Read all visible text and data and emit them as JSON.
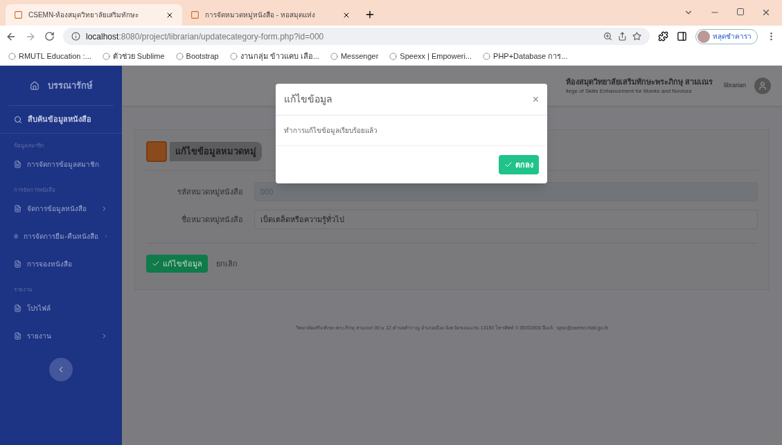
{
  "browser": {
    "tabs": [
      {
        "title": "CSEMN-ห้องสมุดวิทยาลัยเสริมทักษะ",
        "selected": true
      },
      {
        "title": "การจัดหมวดหมู่หนังสือ - หอสมุดแห่ง",
        "selected": false
      }
    ],
    "url_host": "localhost",
    "url_rest": ":8080/project/librarian/updatecategory-form.php?id=000",
    "profile": "หลุดชำคารา",
    "bookmarks": [
      "RMUTL Education :...",
      "ตัวช่วย Sublime",
      "Bootstrap",
      "งานกลุ่ม ข้าวแคบ เลือ...",
      "Messenger",
      "Speexx | Empoweri...",
      "PHP+Database การ..."
    ]
  },
  "sidebar": {
    "title": "บรรณารักษ์",
    "search": "สืบค้นข้อมูลหนังสือ",
    "items": [
      {
        "kind": "header",
        "label": "ข้อมูลสมาชิก"
      },
      {
        "kind": "item",
        "label": "การจัดการข้อมูลสมาชิก",
        "expandable": false
      },
      {
        "kind": "header",
        "label": "การจัดการหนังสือ"
      },
      {
        "kind": "item",
        "label": "จัดการข้อมูลหนังสือ",
        "expandable": true
      },
      {
        "kind": "item",
        "label": "การจัดการยืม-คืนหนังสือ",
        "expandable": true
      },
      {
        "kind": "item",
        "label": "การจองหนังสือ",
        "expandable": false
      },
      {
        "kind": "header",
        "label": "รายงาน"
      },
      {
        "kind": "item",
        "label": "โปรไฟล์",
        "expandable": false
      },
      {
        "kind": "item",
        "label": "รายงาน",
        "expandable": true
      }
    ]
  },
  "header": {
    "title": "ห้องสมุดวิทยาลัยเสริมทักษะพระภิกษุ สามเณร",
    "subtitle": "llege of Skills Enhancement for Monks and Novices",
    "user": "librarian"
  },
  "form": {
    "heading": "แก้ไขข้อมูลหมวดหมู่",
    "fields": [
      {
        "label": "รหัสหมวดหมู่หนังสือ",
        "value": "000",
        "disabled": true
      },
      {
        "label": "ชื่อหมวดหมู่หนังสือ",
        "value": "เบ็ดเตล็ดหรือความรู้ทั่วไป",
        "disabled": false
      }
    ],
    "submit": "แก้ไขข้อมูล",
    "cancel": "ยกเลิก"
  },
  "footer": "วิทยาลัยเสริมทักษะพระภิกษุ สามเณร 00 ม.12 ตำบลสำราญ อำเภอเมือง จังหวัดขอนแก่น 13150 โทรศัพท์ 0 35002606 อีเมล์ : spsc@csemn.mail.go.th",
  "modal": {
    "title": "แก้ไขข้อมูล",
    "message": "ทำการแก้ไขข้อมูลเรียบร้อยแล้ว",
    "button": "ตกลง",
    "close": "×"
  }
}
